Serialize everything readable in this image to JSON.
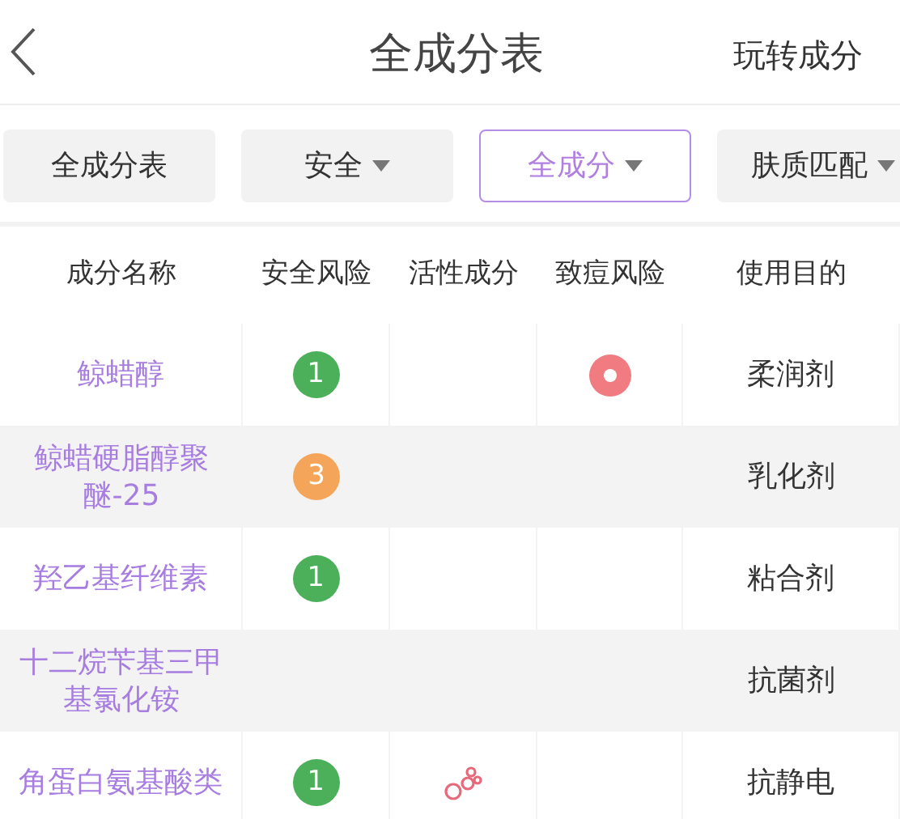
{
  "header": {
    "title": "全成分表",
    "right_link": "玩转成分"
  },
  "filters": [
    {
      "label": "全成分表",
      "dropdown": false,
      "selected": false
    },
    {
      "label": "安全",
      "dropdown": true,
      "selected": false
    },
    {
      "label": "全成分",
      "dropdown": true,
      "selected": true
    },
    {
      "label": "肤质匹配",
      "dropdown": true,
      "selected": false
    }
  ],
  "table": {
    "columns": [
      "成分名称",
      "安全风险",
      "活性成分",
      "致痘风险",
      "使用目的"
    ],
    "rows": [
      {
        "name": "鲸蜡醇",
        "safety": "1",
        "color": "#4caf5a",
        "active": false,
        "acne": true,
        "purpose": "柔润剂"
      },
      {
        "name": "鲸蜡硬脂醇聚醚-25",
        "safety": "3",
        "color": "#f5a55a",
        "active": false,
        "acne": false,
        "purpose": "乳化剂"
      },
      {
        "name": "羟乙基纤维素",
        "safety": "1",
        "color": "#4caf5a",
        "active": false,
        "acne": false,
        "purpose": "粘合剂"
      },
      {
        "name": "十二烷苄基三甲基氯化铵",
        "active": false,
        "acne": false,
        "purpose": "抗菌剂"
      },
      {
        "name": "角蛋白氨基酸类",
        "safety": "1",
        "color": "#4caf5a",
        "active": true,
        "acne": false,
        "purpose": "抗静电"
      }
    ]
  }
}
